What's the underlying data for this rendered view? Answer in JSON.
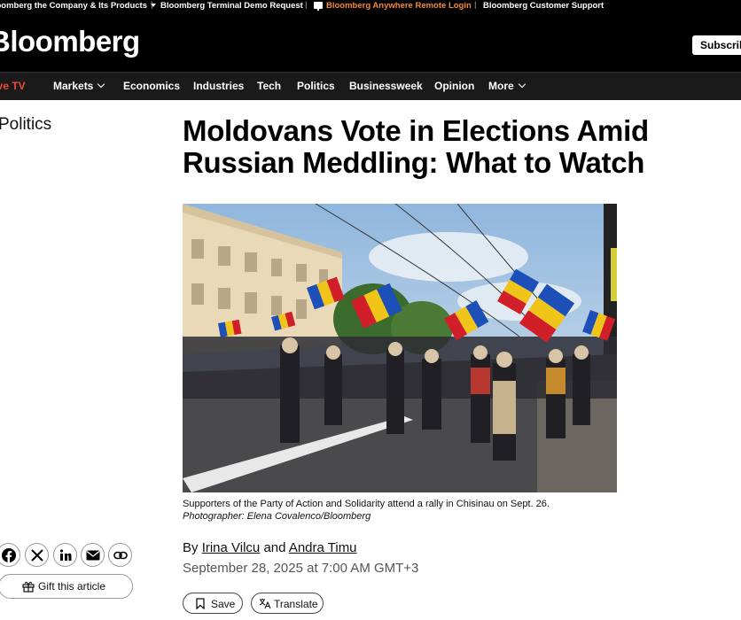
{
  "topbar": {
    "links": [
      "Bloomberg the Company & Its Products",
      "Bloomberg Terminal Demo Request",
      "Bloomberg Anywhere Remote Login",
      "Bloomberg Customer Support"
    ],
    "separator": "|"
  },
  "masthead": {
    "logo": "Bloomberg",
    "subscribe": "Subscribe"
  },
  "nav": {
    "items": [
      "Live TV",
      "Markets",
      "Economics",
      "Industries",
      "Tech",
      "Politics",
      "Businessweek",
      "Opinion",
      "More"
    ],
    "live_color": "#f2483a"
  },
  "article": {
    "section": "Politics",
    "headline_line1": "Moldovans Vote in Elections Amid",
    "headline_line2": "Russian Meddling: What to Watch",
    "caption": "Supporters of the Party of Action and Solidarity attend a rally in Chisinau on Sept. 26.",
    "credit": "Photographer: Elena Covalenco/Bloomberg",
    "byline_prefix": "By",
    "author1": "Irina Vilcu",
    "byline_and": "and",
    "author2": "Andra Timu",
    "date": "September 28, 2025 at 7:00 AM GMT+3"
  },
  "actions": {
    "share_icons": [
      "facebook-icon",
      "x-icon",
      "linkedin-icon",
      "email-icon",
      "link-icon"
    ],
    "gift": "Gift this article",
    "save": "Save",
    "translate": "Translate"
  }
}
